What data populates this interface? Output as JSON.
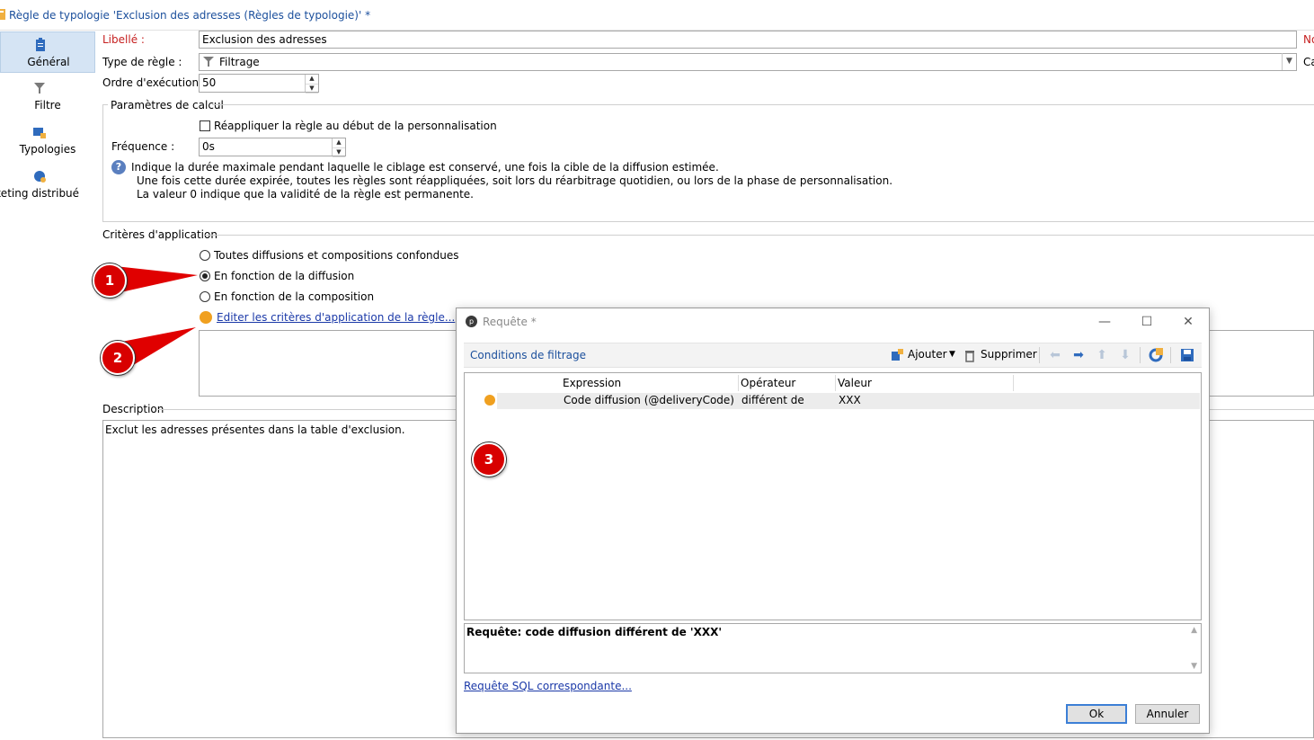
{
  "window": {
    "title": "Règle de typologie 'Exclusion des adresses (Règles de typologie)' *"
  },
  "nav": {
    "items": [
      {
        "label": "Général",
        "icon": "general-icon",
        "active": true
      },
      {
        "label": "Filtre",
        "icon": "filter-icon",
        "active": false
      },
      {
        "label": "Typologies",
        "icon": "typologies-icon",
        "active": false
      },
      {
        "label": "arketing distribué",
        "icon": "distributed-marketing-icon",
        "active": false
      }
    ]
  },
  "form": {
    "libelle_label": "Libellé :",
    "libelle_value": "Exclusion des adresses",
    "right_cut_1": "No",
    "type_label": "Type de règle :",
    "type_value": "Filtrage",
    "right_cut_2": "Ca",
    "ordre_label": "Ordre d'exécution :",
    "ordre_value": "50"
  },
  "calc": {
    "group_title": "Paramètres de calcul",
    "reapply_label": "Réappliquer la règle au début de la personnalisation",
    "reapply_checked": false,
    "freq_label": "Fréquence :",
    "freq_value": "0s",
    "info_line1": "Indique la durée maximale pendant laquelle le ciblage est conservé, une fois la cible de la diffusion estimée.",
    "info_line2": "Une fois cette durée expirée, toutes les règles sont réappliquées, soit lors du réarbitrage quotidien, ou lors de la phase de personnalisation.",
    "info_line3": "La valeur 0 indique que la validité de la règle est permanente."
  },
  "criteria": {
    "group_title": "Critères d'application",
    "options": [
      {
        "label": "Toutes diffusions et compositions confondues",
        "selected": false
      },
      {
        "label": "En fonction de la diffusion",
        "selected": true
      },
      {
        "label": "En fonction de la composition",
        "selected": false
      }
    ],
    "edit_link": "Editer les critères d'application de la règle..."
  },
  "description": {
    "label": "Description",
    "text": "Exclut les adresses présentes dans la table d'exclusion."
  },
  "dialog": {
    "title": "Requête *",
    "toolbar_title": "Conditions de filtrage",
    "add_label": "Ajouter",
    "delete_label": "Supprimer",
    "columns": [
      "Expression",
      "Opérateur",
      "Valeur"
    ],
    "rows": [
      {
        "expression": "Code diffusion (@deliveryCode)",
        "operator": "différent de",
        "value": "XXX"
      }
    ],
    "summary": "Requête: code diffusion différent de 'XXX'",
    "sql_link": "Requête SQL correspondante...",
    "ok_label": "Ok",
    "cancel_label": "Annuler"
  },
  "callouts": [
    "1",
    "2",
    "3"
  ],
  "colors": {
    "accent": "#1b4f9c",
    "required_label": "#c62020",
    "callout": "#d80000",
    "condition_dot": "#f0a020",
    "link": "#1b39a8"
  }
}
